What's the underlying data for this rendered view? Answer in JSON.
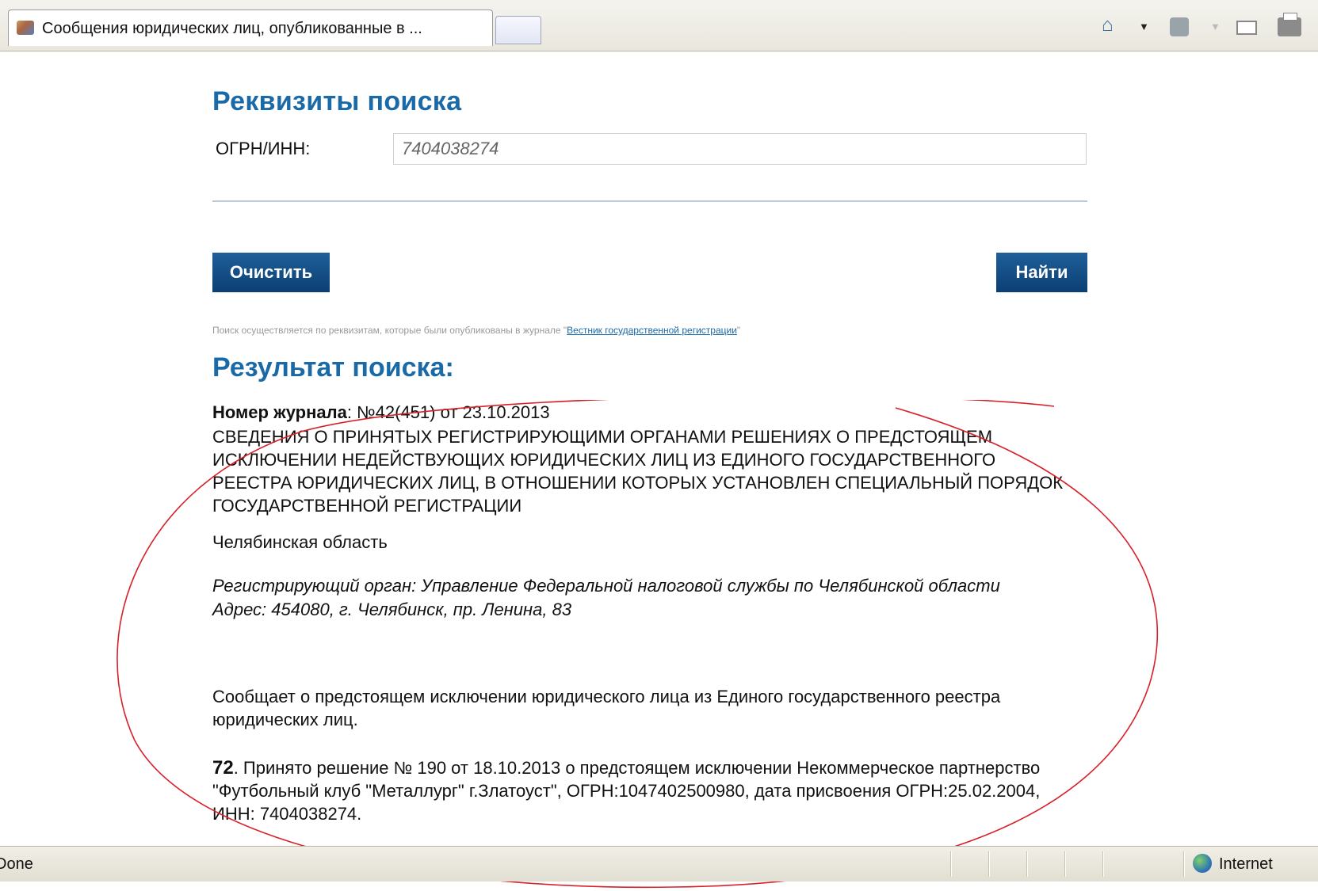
{
  "browser": {
    "tab_title": "Сообщения юридических лиц, опубликованные в ...",
    "status_text": "Done",
    "zone_label": "Internet"
  },
  "search": {
    "heading": "Реквизиты поиска",
    "ogrn_label": "ОГРН/ИНН:",
    "ogrn_value": "7404038274",
    "clear_button": "Очистить",
    "find_button": "Найти",
    "note_text": "Поиск осуществляется по реквизитам, которые были опубликованы в журнале \"",
    "note_link": "Вестник государственной регистрации",
    "note_tail": "\""
  },
  "result": {
    "heading": "Результат поиска:",
    "journal_label": "Номер журнала",
    "journal_value": ": №42(451) от 23.10.2013",
    "section_title": "СВЕДЕНИЯ О ПРИНЯТЫХ РЕГИСТРИРУЮЩИМИ ОРГАНАМИ РЕШЕНИЯХ О ПРЕДСТОЯЩЕМ ИСКЛЮЧЕНИИ НЕДЕЙСТВУЮЩИХ ЮРИДИЧЕСКИХ ЛИЦ ИЗ ЕДИНОГО ГОСУДАРСТВЕННОГО РЕЕСТРА ЮРИДИЧЕСКИХ ЛИЦ, В ОТНОШЕНИИ КОТОРЫХ УСТАНОВЛЕН СПЕЦИАЛЬНЫЙ ПОРЯДОК ГОСУДАРСТВЕННОЙ РЕГИСТРАЦИИ",
    "region": "Челябинская область",
    "authority": "Регистрирующий орган: Управление Федеральной налоговой службы по Челябинской области",
    "address": "Адрес: 454080, г. Челябинск, пр. Ленина, 83",
    "message": "Сообщает о предстоящем исключении юридического лица из Единого государственного реестра юридических лиц.",
    "entry_number": "72",
    "entry_text": ". Принято решение № 190 от 18.10.2013 о предстоящем исключении Некоммерческое партнерство \"Футбольный клуб \"Металлург\" г.Златоуст\", ОГРН:1047402500980, дата присвоения ОГРН:25.02.2004, ИНН: 7404038274."
  },
  "colors": {
    "heading": "#1a6aa8",
    "button": "#0b3f73",
    "annotation_ellipse": "#d8202a"
  }
}
